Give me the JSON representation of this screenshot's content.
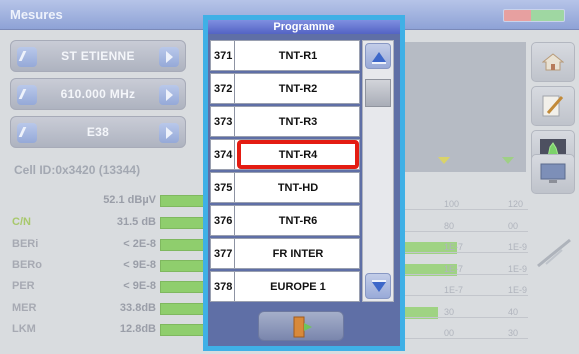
{
  "window": {
    "title": "Mesures"
  },
  "tuner": {
    "site": "ST ETIENNE",
    "frequency": "610.000 MHz",
    "channel": "E38"
  },
  "cell_id": "Cell ID:0x3420 (13344)",
  "measurements": [
    {
      "label": "",
      "value": "52.1 dBµV",
      "green_label": true
    },
    {
      "label": "C/N",
      "value": "31.5 dB",
      "green_label": true
    },
    {
      "label": "BERi",
      "value": "< 2E-8",
      "green_label": false
    },
    {
      "label": "BERo",
      "value": "< 9E-8",
      "green_label": false
    },
    {
      "label": "PER",
      "value": "< 9E-8",
      "green_label": false
    },
    {
      "label": "MER",
      "value": "33.8dB",
      "green_label": false
    },
    {
      "label": "LKM",
      "value": "12.8dB",
      "green_label": false
    }
  ],
  "scales": [
    {
      "a": "100",
      "b": "120",
      "fill": 0.0
    },
    {
      "a": "80",
      "b": "00",
      "fill": 0.0
    },
    {
      "a": "1E-7",
      "b": "1E-9",
      "fill": 0.45
    },
    {
      "a": "1E-7",
      "b": "1E-9",
      "fill": 0.45
    },
    {
      "a": "1E-7",
      "b": "1E-9",
      "fill": 0.0
    },
    {
      "a": "30",
      "b": "40",
      "fill": 0.3
    },
    {
      "a": "00",
      "b": "30",
      "fill": 0.0
    }
  ],
  "side_icons": [
    "home-icon",
    "edit-icon",
    "spectrum-icon",
    "monitor-icon"
  ],
  "programme": {
    "title": "Programme",
    "items": [
      {
        "num": "371",
        "name": "TNT-R1"
      },
      {
        "num": "372",
        "name": "TNT-R2"
      },
      {
        "num": "373",
        "name": "TNT-R3"
      },
      {
        "num": "374",
        "name": "TNT-R4"
      },
      {
        "num": "375",
        "name": "TNT-HD"
      },
      {
        "num": "376",
        "name": "TNT-R6"
      },
      {
        "num": "377",
        "name": "FR INTER"
      },
      {
        "num": "378",
        "name": "EUROPE 1"
      }
    ],
    "selected_index": 3
  },
  "colors": {
    "modal_border": "#3fb0e6",
    "selection": "#e41c12",
    "titlebar": "#8ea2d6"
  }
}
